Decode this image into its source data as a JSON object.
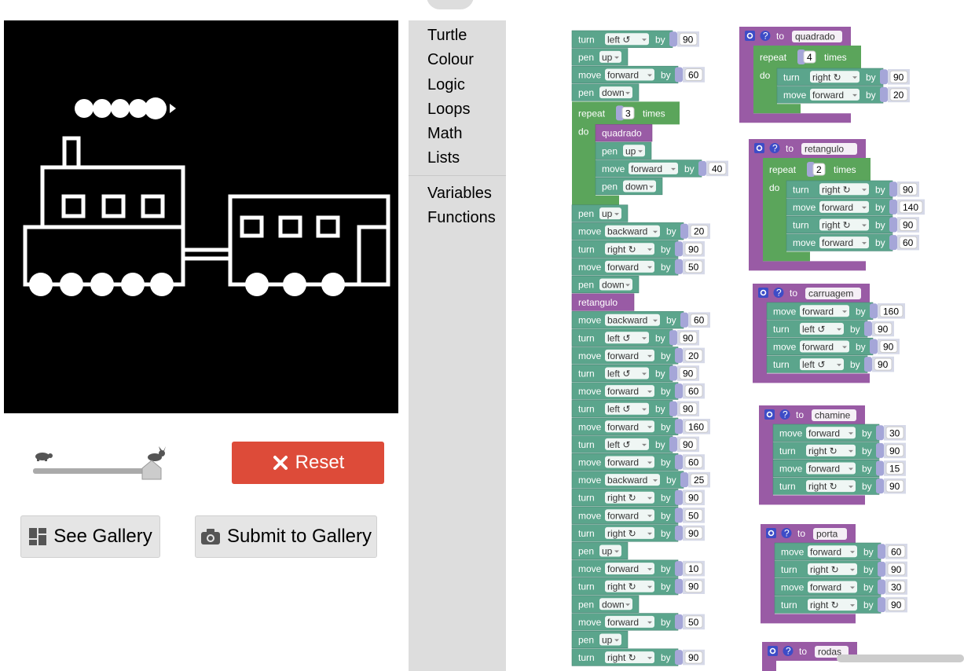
{
  "toolbox": {
    "categories": [
      "Turtle",
      "Colour",
      "Logic",
      "Loops",
      "Math",
      "Lists"
    ],
    "categories2": [
      "Variables",
      "Functions"
    ]
  },
  "controls": {
    "reset_label": "Reset",
    "see_gallery_label": "See Gallery",
    "submit_gallery_label": "Submit to Gallery",
    "speed_value": 0.97
  },
  "colors": {
    "turtle_block": "#5ba58c",
    "loop_block": "#5ba55b",
    "procedure_block": "#995ba5",
    "reset_button": "#dd4b39",
    "canvas_bg": "#000000",
    "toolbox_bg": "#dddddd"
  },
  "blocks": {
    "main_stack": [
      {
        "kind": "turn",
        "dir": "left ↺",
        "val": "90"
      },
      {
        "kind": "pen",
        "state": "up"
      },
      {
        "kind": "move",
        "dir": "forward",
        "val": "60"
      },
      {
        "kind": "pen",
        "state": "down"
      },
      {
        "kind": "repeat",
        "times": "3",
        "body": [
          {
            "kind": "call",
            "name": "quadrado"
          },
          {
            "kind": "pen",
            "state": "up"
          },
          {
            "kind": "move",
            "dir": "forward",
            "val": "40"
          },
          {
            "kind": "pen",
            "state": "down"
          }
        ]
      },
      {
        "kind": "pen",
        "state": "up"
      },
      {
        "kind": "move",
        "dir": "backward",
        "val": "20"
      },
      {
        "kind": "turn",
        "dir": "right ↻",
        "val": "90"
      },
      {
        "kind": "move",
        "dir": "forward",
        "val": "50"
      },
      {
        "kind": "pen",
        "state": "down"
      },
      {
        "kind": "call",
        "name": "retangulo"
      },
      {
        "kind": "move",
        "dir": "backward",
        "val": "60"
      },
      {
        "kind": "turn",
        "dir": "left ↺",
        "val": "90"
      },
      {
        "kind": "move",
        "dir": "forward",
        "val": "20"
      },
      {
        "kind": "turn",
        "dir": "left ↺",
        "val": "90"
      },
      {
        "kind": "move",
        "dir": "forward",
        "val": "60"
      },
      {
        "kind": "turn",
        "dir": "left ↺",
        "val": "90"
      },
      {
        "kind": "move",
        "dir": "forward",
        "val": "160"
      },
      {
        "kind": "turn",
        "dir": "left ↺",
        "val": "90"
      },
      {
        "kind": "move",
        "dir": "forward",
        "val": "60"
      },
      {
        "kind": "move",
        "dir": "backward",
        "val": "25"
      },
      {
        "kind": "turn",
        "dir": "right ↻",
        "val": "90"
      },
      {
        "kind": "move",
        "dir": "forward",
        "val": "50"
      },
      {
        "kind": "turn",
        "dir": "right ↻",
        "val": "90"
      },
      {
        "kind": "pen",
        "state": "up"
      },
      {
        "kind": "move",
        "dir": "forward",
        "val": "10"
      },
      {
        "kind": "turn",
        "dir": "right ↻",
        "val": "90"
      },
      {
        "kind": "pen",
        "state": "down"
      },
      {
        "kind": "move",
        "dir": "forward",
        "val": "50"
      },
      {
        "kind": "pen",
        "state": "up"
      },
      {
        "kind": "turn",
        "dir": "right ↻",
        "val": "90"
      }
    ],
    "procedures": [
      {
        "name": "quadrado",
        "body": [
          {
            "kind": "repeat",
            "times": "4",
            "body": [
              {
                "kind": "turn",
                "dir": "right ↻",
                "val": "90"
              },
              {
                "kind": "move",
                "dir": "forward",
                "val": "20"
              }
            ]
          }
        ]
      },
      {
        "name": "retangulo",
        "body": [
          {
            "kind": "repeat",
            "times": "2",
            "body": [
              {
                "kind": "turn",
                "dir": "right ↻",
                "val": "90"
              },
              {
                "kind": "move",
                "dir": "forward",
                "val": "140"
              },
              {
                "kind": "turn",
                "dir": "right ↻",
                "val": "90"
              },
              {
                "kind": "move",
                "dir": "forward",
                "val": "60"
              }
            ]
          }
        ]
      },
      {
        "name": "carruagem",
        "body": [
          {
            "kind": "move",
            "dir": "forward",
            "val": "160"
          },
          {
            "kind": "turn",
            "dir": "left ↺",
            "val": "90"
          },
          {
            "kind": "move",
            "dir": "forward",
            "val": "90"
          },
          {
            "kind": "turn",
            "dir": "left ↺",
            "val": "90"
          }
        ]
      },
      {
        "name": "chamine",
        "body": [
          {
            "kind": "move",
            "dir": "forward",
            "val": "30"
          },
          {
            "kind": "turn",
            "dir": "right ↻",
            "val": "90"
          },
          {
            "kind": "move",
            "dir": "forward",
            "val": "15"
          },
          {
            "kind": "turn",
            "dir": "right ↻",
            "val": "90"
          }
        ]
      },
      {
        "name": "porta",
        "body": [
          {
            "kind": "move",
            "dir": "forward",
            "val": "60"
          },
          {
            "kind": "turn",
            "dir": "right ↻",
            "val": "90"
          },
          {
            "kind": "move",
            "dir": "forward",
            "val": "30"
          },
          {
            "kind": "turn",
            "dir": "right ↻",
            "val": "90"
          }
        ]
      },
      {
        "name": "rodas",
        "body": []
      }
    ]
  },
  "labels": {
    "turn": "turn",
    "pen": "pen",
    "move": "move",
    "by": "by",
    "repeat": "repeat",
    "times": "times",
    "do": "do",
    "to": "to"
  }
}
